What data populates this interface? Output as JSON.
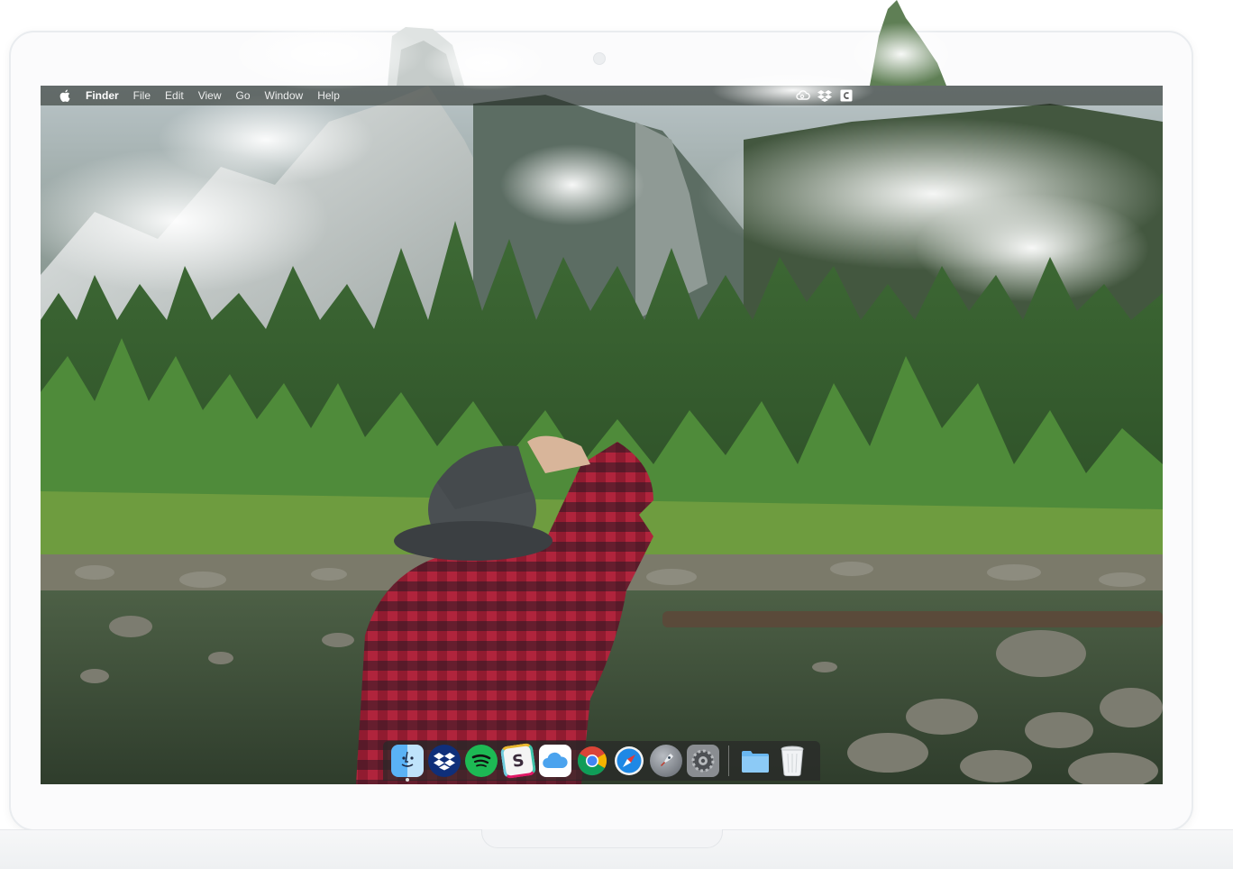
{
  "menubar": {
    "apple_icon": "apple-logo-icon",
    "app_name": "Finder",
    "items": [
      "File",
      "Edit",
      "View",
      "Go",
      "Window",
      "Help"
    ],
    "status_icons": [
      "creative-cloud-icon",
      "dropbox-status-icon",
      "contacts-status-icon"
    ]
  },
  "dock": {
    "apps": [
      {
        "name": "finder-icon",
        "running": true
      },
      {
        "name": "dropbox-icon",
        "running": false
      },
      {
        "name": "spotify-icon",
        "running": false
      },
      {
        "name": "slack-icon",
        "running": false,
        "glyph": "S"
      },
      {
        "name": "icloud-drive-icon",
        "running": false
      },
      {
        "name": "chrome-icon",
        "running": false
      },
      {
        "name": "safari-icon",
        "running": false
      },
      {
        "name": "launchpad-icon",
        "running": false
      },
      {
        "name": "system-preferences-icon",
        "running": false
      }
    ],
    "stacks": [
      {
        "name": "downloads-folder-icon"
      },
      {
        "name": "trash-icon"
      }
    ]
  },
  "colors": {
    "menubar_bg": "#1e231e",
    "dock_bg": "#282828",
    "spotify": "#1db954",
    "dropbox": "#0061fe",
    "safari": "#1e88e5",
    "folder": "#6ab7f0"
  }
}
